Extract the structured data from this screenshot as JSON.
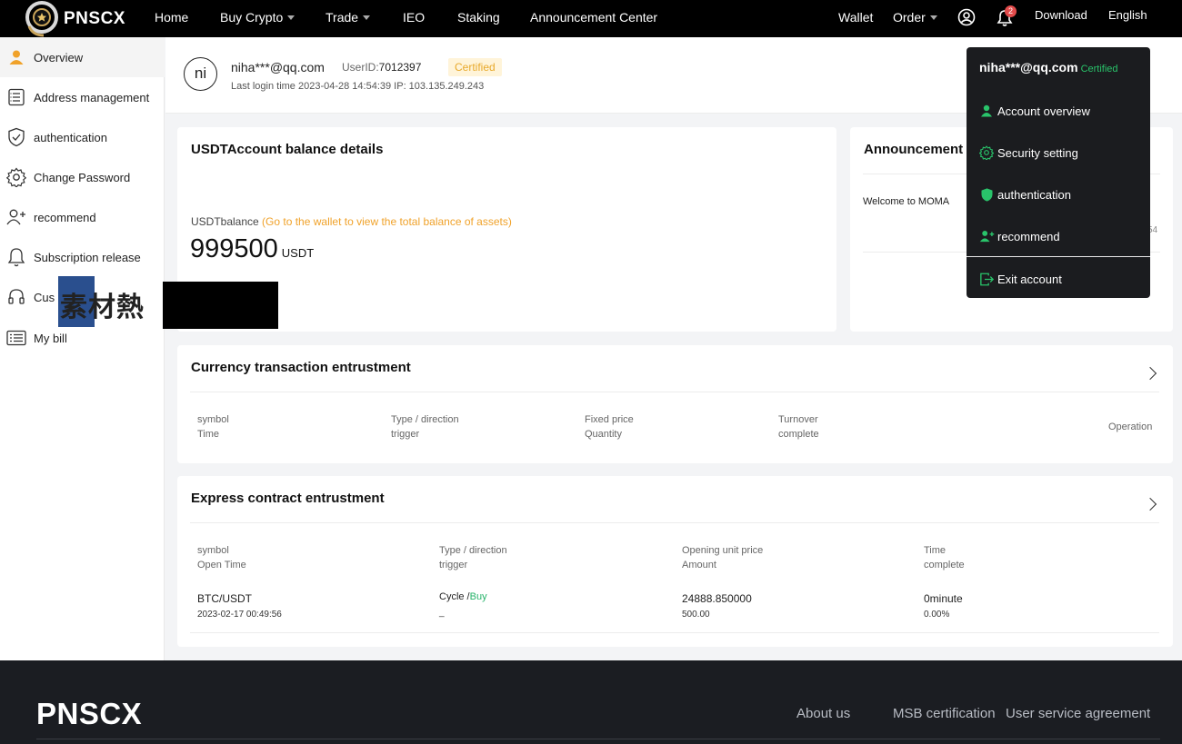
{
  "nav": {
    "brand": "PNSCX",
    "items": [
      "Home",
      "Buy Crypto",
      "Trade",
      "IEO",
      "Staking",
      "Announcement Center"
    ],
    "right": {
      "wallet": "Wallet",
      "order": "Order",
      "notif_count": "2",
      "download": "Download",
      "language": "English"
    }
  },
  "sidebar": {
    "items": [
      {
        "label": "Overview",
        "icon": "user-icon"
      },
      {
        "label": "Address management",
        "icon": "list-icon"
      },
      {
        "label": "authentication",
        "icon": "shield-icon"
      },
      {
        "label": "Change Password",
        "icon": "gear-icon"
      },
      {
        "label": "recommend",
        "icon": "user-add-icon"
      },
      {
        "label": "Subscription release",
        "icon": "bell-icon"
      },
      {
        "label": "Cus",
        "icon": "headset-icon"
      },
      {
        "label": "My bill",
        "icon": "bill-icon"
      }
    ]
  },
  "user": {
    "avatar_initials": "ni",
    "email": "niha***@qq.com",
    "userid_label": "UserID:",
    "userid": "7012397",
    "certified": "Certified",
    "last_login": "Last login time 2023-04-28 14:54:39  IP: 103.135.249.243"
  },
  "balance": {
    "title": "USDTAccount balance details",
    "label": "USDTbalance ",
    "wallet_link": "(Go to the wallet to view the total balance of assets)",
    "value": "999500",
    "unit": "USDT"
  },
  "announcement": {
    "title": "Announcement C",
    "item": "Welcome to MOMA",
    "item_tail": "54"
  },
  "currency_tx": {
    "title": "Currency transaction entrustment",
    "headers": [
      [
        "symbol",
        "Time"
      ],
      [
        "Type / direction",
        "trigger"
      ],
      [
        "Fixed price",
        "Quantity"
      ],
      [
        "Turnover",
        "complete"
      ]
    ],
    "operation": "Operation"
  },
  "express": {
    "title": "Express contract entrustment",
    "headers": [
      [
        "symbol",
        "Open Time"
      ],
      [
        "Type / direction",
        "trigger"
      ],
      [
        "Opening unit price",
        "Amount"
      ],
      [
        "Time",
        "complete"
      ]
    ],
    "row": {
      "symbol": "BTC/USDT",
      "open_time": "2023-02-17 00:49:56",
      "type": "Cycle /",
      "direction": "Buy",
      "trigger": "_",
      "price": "24888.850000",
      "amount": "500.00",
      "time": "0minute",
      "complete": "0.00%"
    }
  },
  "dropdown": {
    "email": "niha***@qq.com",
    "certified": "Certified",
    "items": [
      "Account overview",
      "Security setting",
      "authentication",
      "recommend"
    ],
    "exit": "Exit account"
  },
  "watermark": {
    "text": "素材熱"
  },
  "footer": {
    "brand": "PNSCX",
    "links": [
      "About us",
      "MSB certification",
      "User service agreement"
    ]
  },
  "colors": {
    "accent": "#f0a22a",
    "green": "#29c36a",
    "nav_bg": "#000000",
    "footer_bg": "#1b1d22"
  }
}
